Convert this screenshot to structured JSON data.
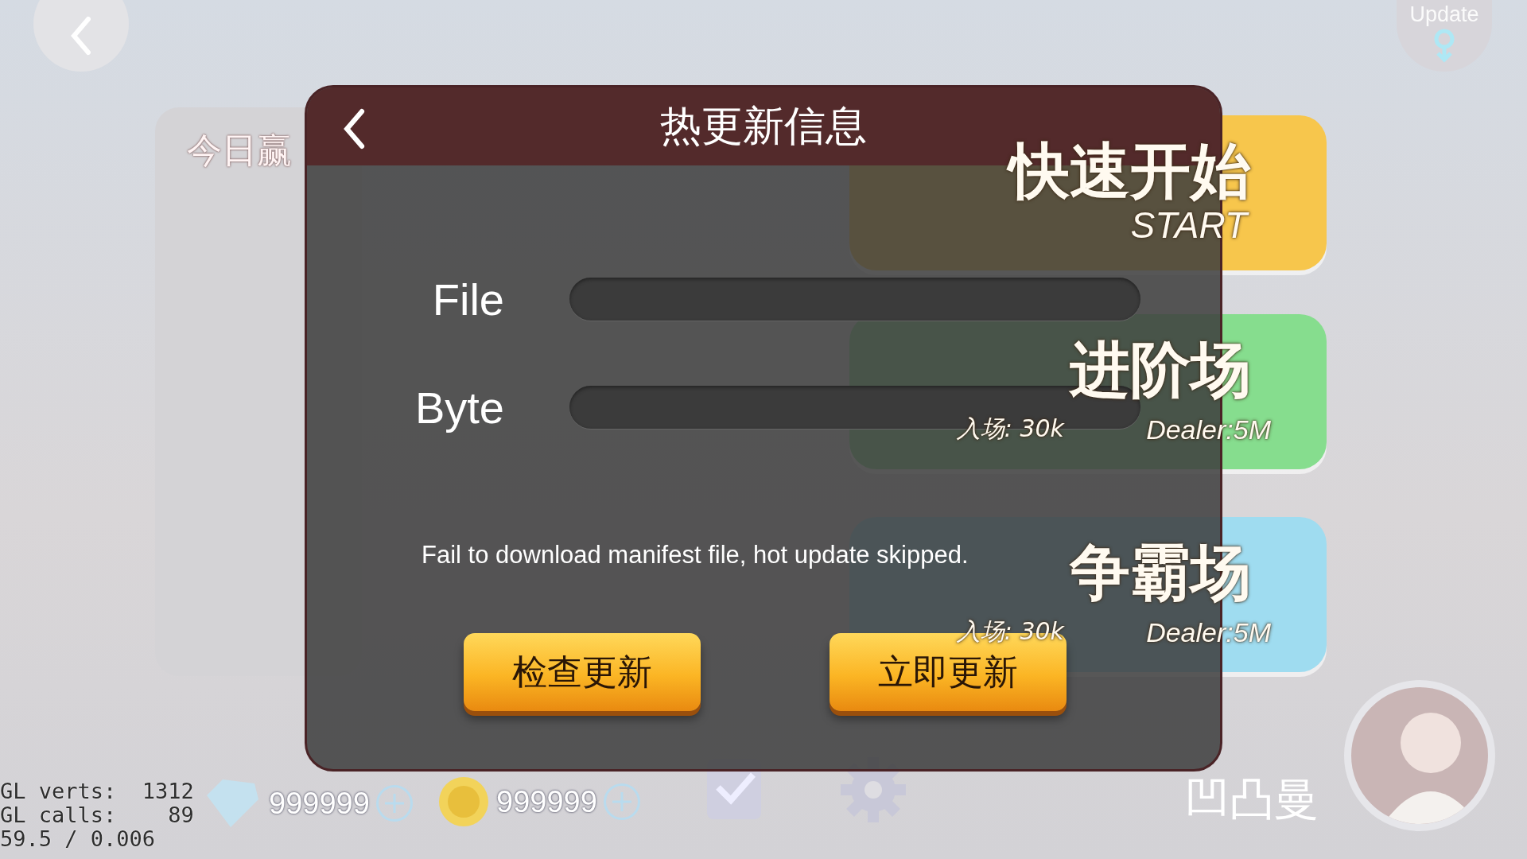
{
  "background": {
    "update_label": "Update",
    "left_panel_title": "今日赢",
    "mode_cards": [
      {
        "kind": "start",
        "title": "快速开始",
        "subtitle": "START",
        "color": "#f7c64c"
      },
      {
        "kind": "room",
        "title": "进阶场",
        "entry": "入场: 30k",
        "dealer": "Dealer:5M",
        "color": "#86dd8e"
      },
      {
        "kind": "room",
        "title": "争霸场",
        "entry": "入场: 30k",
        "dealer": "Dealer:5M",
        "color": "#9fdcf0"
      }
    ],
    "currencies": [
      {
        "kind": "diamond",
        "amount": "999999"
      },
      {
        "kind": "coin",
        "amount": "999999"
      }
    ],
    "player_name": "凹凸曼"
  },
  "debug_stats": [
    "GL verts:  1312",
    "GL calls:    89",
    "59.5 / 0.006"
  ],
  "dialog": {
    "title": "热更新信息",
    "fields": [
      {
        "label": "File",
        "level": 0
      },
      {
        "label": "Byte",
        "level": 0
      }
    ],
    "message": "Fail to download manifest file, hot update skipped.",
    "buttons": [
      "检查更新",
      "立即更新"
    ]
  }
}
